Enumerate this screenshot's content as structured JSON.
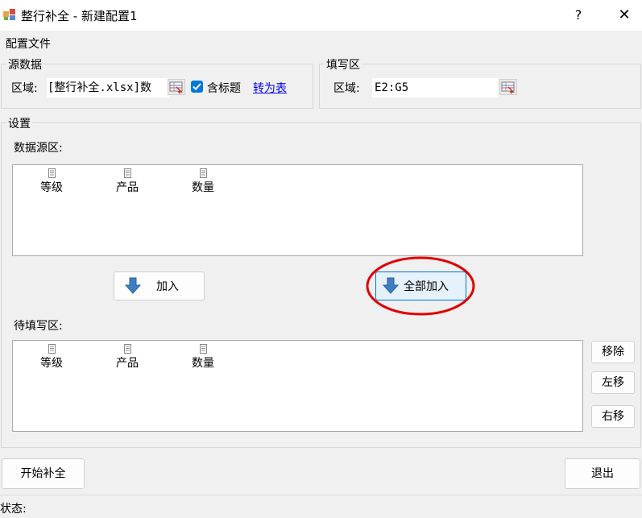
{
  "window": {
    "title": "整行补全 - 新建配置1",
    "help_label": "?",
    "close_label": "✕"
  },
  "menu": {
    "config_file": "配置文件"
  },
  "source": {
    "legend": "源数据",
    "region_label": "区域:",
    "region_value": "[整行补全.xlsx]数",
    "has_header_label": "含标题",
    "has_header_checked": true,
    "to_table_link": "转为表"
  },
  "fill": {
    "legend": "填写区",
    "region_label": "区域:",
    "region_value": "E2:G5"
  },
  "settings": {
    "legend": "设置",
    "source_area_label": "数据源区:",
    "source_columns": [
      "等级",
      "产品",
      "数量"
    ],
    "add_button": "加入",
    "add_all_button": "全部加入",
    "pending_area_label": "待填写区:",
    "pending_columns": [
      "等级",
      "产品",
      "数量"
    ],
    "remove_button": "移除",
    "move_left_button": "左移",
    "move_right_button": "右移"
  },
  "actions": {
    "start_button": "开始补全",
    "exit_button": "退出"
  },
  "status": {
    "label": "状态:"
  },
  "colors": {
    "accent": "#0078d7",
    "link": "#0000ee",
    "highlight_ring": "#e00000",
    "arrow": "#3d7fc4"
  }
}
